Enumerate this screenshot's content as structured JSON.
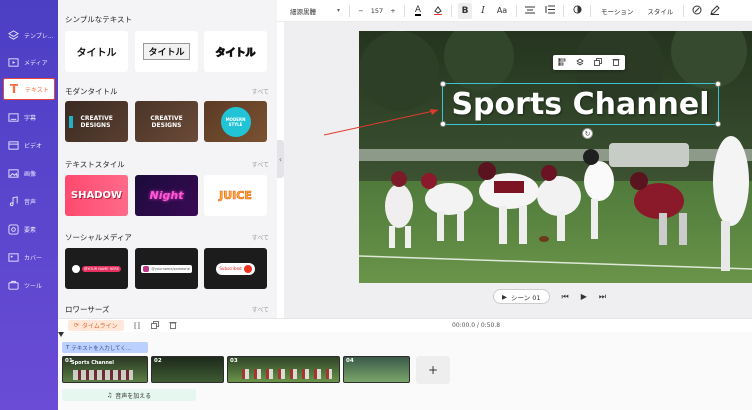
{
  "nav": {
    "items": [
      {
        "label": "テンプレ...",
        "icon": "layers-icon"
      },
      {
        "label": "メディア",
        "icon": "media-icon"
      },
      {
        "label": "テキスト",
        "icon": "text-icon"
      },
      {
        "label": "字幕",
        "icon": "subtitle-icon"
      },
      {
        "label": "ビデオ",
        "icon": "video-icon"
      },
      {
        "label": "画像",
        "icon": "image-icon"
      },
      {
        "label": "音声",
        "icon": "music-icon"
      },
      {
        "label": "要素",
        "icon": "elements-icon"
      },
      {
        "label": "カバー",
        "icon": "cover-icon"
      },
      {
        "label": "ツール",
        "icon": "tools-icon"
      }
    ],
    "active_index": 2
  },
  "panel": {
    "see_all": "すべて",
    "simple_title": "シンプルなテキスト",
    "simple_cards": [
      "タイトル",
      "タイトル",
      "タイトル"
    ],
    "modern_title": "モダンタイトル",
    "modern_cards": [
      "CREATIVE DESIGNS",
      "CREATIVE DESIGNS",
      "MODERN STYLE"
    ],
    "style_title": "テキストスタイル",
    "style_cards": [
      "SHADOW",
      "Night",
      "JUICE"
    ],
    "social_title": "ソーシャルメディア",
    "social_cards": [
      "@YOUR NAME HERE",
      "@yourname/someone",
      "Subscribed"
    ],
    "lower_title": "ロワーサーズ"
  },
  "toolbar": {
    "font": "細源黒體",
    "font_size": "157",
    "minus": "−",
    "plus": "+",
    "bold": "B",
    "italic": "I",
    "case": "Aa",
    "motion": "モーション",
    "style": "スタイル"
  },
  "canvas": {
    "title_text": "Sports Channel"
  },
  "scene": {
    "label": "シーン 01"
  },
  "timeline": {
    "label": "タイムライン",
    "time": "00:00.0 / 0:50.8",
    "text_track": "テキストを入力してく...",
    "clip1_text": "Sports Channel",
    "clips": [
      "01",
      "02",
      "03",
      "04"
    ],
    "add": "+",
    "audio": "音声を加える"
  },
  "colors": {
    "nav_bg": "#5a45cf",
    "accent": "#ff6b3d",
    "arrow": "#e23a2f"
  }
}
